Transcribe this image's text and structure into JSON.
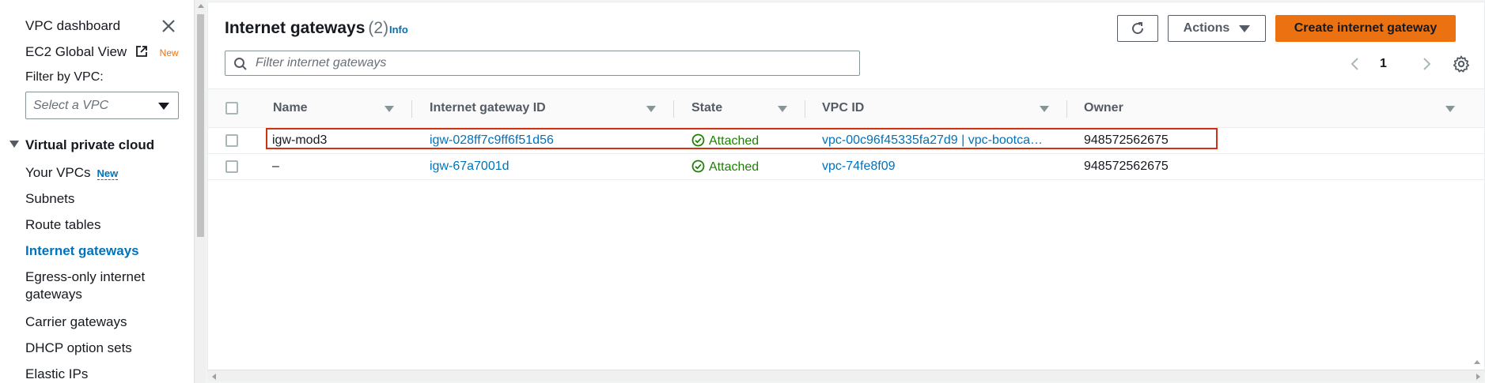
{
  "sidebar": {
    "close_icon": "close-icon",
    "items_top": [
      {
        "label": "VPC dashboard"
      },
      {
        "label": "EC2 Global View",
        "badge": "New",
        "icon": "external-link-icon"
      }
    ],
    "filter_label": "Filter by VPC:",
    "select_placeholder": "Select a VPC",
    "section_title": "Virtual private cloud",
    "items": [
      {
        "label": "Your VPCs",
        "badge": "New"
      },
      {
        "label": "Subnets"
      },
      {
        "label": "Route tables"
      },
      {
        "label": "Internet gateways",
        "active": true
      },
      {
        "label_line1": "Egress-only internet",
        "label_line2": "gateways"
      },
      {
        "label": "Carrier gateways"
      },
      {
        "label": "DHCP option sets"
      },
      {
        "label": "Elastic IPs"
      }
    ]
  },
  "header": {
    "title": "Internet gateways",
    "count": "(2)",
    "info": "Info",
    "refresh_icon": "refresh-icon",
    "actions_label": "Actions",
    "create_label": "Create internet gateway"
  },
  "search": {
    "placeholder": "Filter internet gateways",
    "icon": "search-icon"
  },
  "pagination": {
    "current_page": "1",
    "prev_icon": "chevron-left-icon",
    "next_icon": "chevron-right-icon",
    "settings_icon": "gear-icon"
  },
  "table": {
    "columns": [
      "Name",
      "Internet gateway ID",
      "State",
      "VPC ID",
      "Owner"
    ],
    "rows": [
      {
        "name": "igw-mod3",
        "id": "igw-028ff7c9ff6f51d56",
        "state": "Attached",
        "vpc": "vpc-00c96f45335fa27d9 | vpc-bootca…",
        "owner": "948572562675",
        "highlighted": true
      },
      {
        "name": "–",
        "id": "igw-67a7001d",
        "state": "Attached",
        "vpc": "vpc-74fe8f09",
        "owner": "948572562675",
        "highlighted": false
      }
    ]
  },
  "colors": {
    "accent": "#0073bb",
    "primary_button": "#ec7211",
    "success": "#1d8102",
    "highlight_border": "#d13212"
  }
}
